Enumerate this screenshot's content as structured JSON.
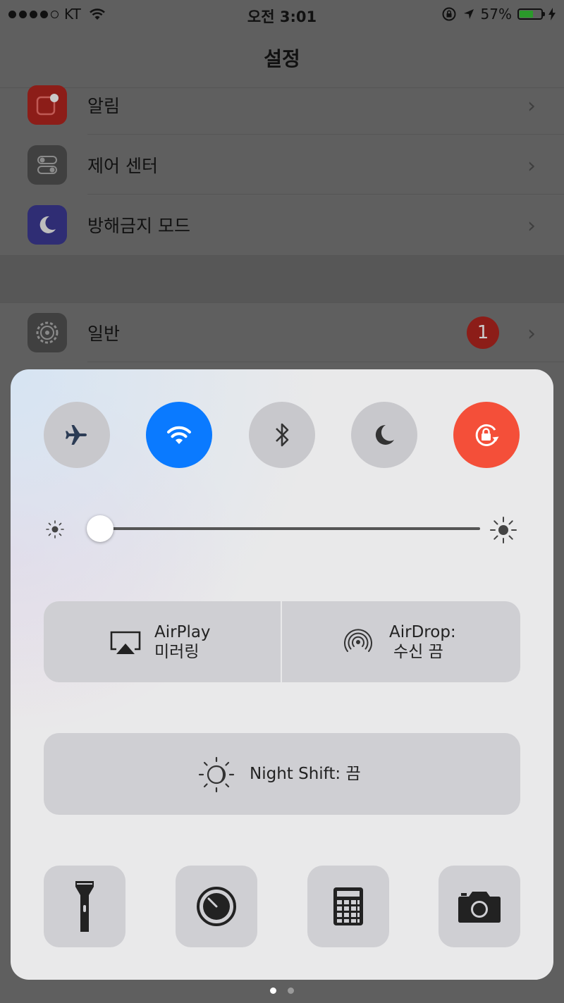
{
  "status_bar": {
    "carrier": "KT",
    "time": "오전 3:01",
    "battery_percent": "57%",
    "signal_bars_filled": 4,
    "signal_bars_total": 5,
    "battery_level": 0.57
  },
  "nav": {
    "title": "설정"
  },
  "settings_rows": [
    {
      "label": "알림",
      "icon": "notifications-icon",
      "color": "#8c1d18"
    },
    {
      "label": "제어 센터",
      "icon": "control-center-icon",
      "color": "#404040"
    },
    {
      "label": "방해금지 모드",
      "icon": "moon-icon",
      "color": "#2f2d74"
    },
    {
      "label": "일반",
      "icon": "gear-icon",
      "color": "#404040",
      "badge": "1"
    }
  ],
  "control_center": {
    "toggles": [
      {
        "name": "airplane-mode",
        "icon": "airplane-icon",
        "on": false
      },
      {
        "name": "wifi",
        "icon": "wifi-icon",
        "on": true,
        "color": "#0a7aff"
      },
      {
        "name": "bluetooth",
        "icon": "bluetooth-icon",
        "on": false
      },
      {
        "name": "do-not-disturb",
        "icon": "moon-icon",
        "on": false
      },
      {
        "name": "rotation-lock",
        "icon": "rotation-lock-icon",
        "on": true,
        "color": "#f44f39"
      }
    ],
    "brightness": 0.03,
    "airplay": {
      "line1": "AirPlay",
      "line2": "미러링"
    },
    "airdrop": {
      "line1": "AirDrop:",
      "line2": "수신 끔"
    },
    "night_shift": {
      "label": "Night Shift: 끔"
    },
    "tools": [
      "flashlight-icon",
      "timer-icon",
      "calculator-icon",
      "camera-icon"
    ],
    "page_count": 2,
    "active_page": 0
  }
}
